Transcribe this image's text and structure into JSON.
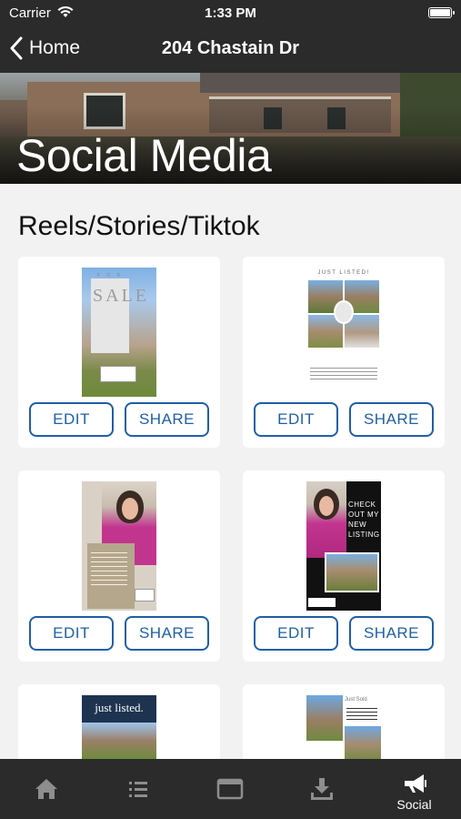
{
  "status_bar": {
    "carrier": "Carrier",
    "time": "1:33 PM"
  },
  "nav": {
    "back_label": "Home",
    "title": "204 Chastain Dr"
  },
  "hero": {
    "title": "Social Media"
  },
  "section": {
    "title": "Reels/Stories/Tiktok"
  },
  "cards": [
    {
      "edit_label": "EDIT",
      "share_label": "SHARE",
      "thumb": {
        "top_text": "F O R",
        "headline": "SALE"
      }
    },
    {
      "edit_label": "EDIT",
      "share_label": "SHARE",
      "thumb": {
        "headline": "JUST LISTED!"
      }
    },
    {
      "edit_label": "EDIT",
      "share_label": "SHARE"
    },
    {
      "edit_label": "EDIT",
      "share_label": "SHARE",
      "thumb": {
        "headline": "CHECK OUT MY NEW LISTING"
      }
    },
    {
      "thumb": {
        "headline": "just listed."
      }
    },
    {
      "thumb": {
        "headline": "Just Sold"
      }
    }
  ],
  "tabs": [
    {
      "icon": "home-icon",
      "label": ""
    },
    {
      "icon": "list-icon",
      "label": ""
    },
    {
      "icon": "browser-icon",
      "label": ""
    },
    {
      "icon": "download-icon",
      "label": ""
    },
    {
      "icon": "megaphone-icon",
      "label": "Social"
    }
  ],
  "colors": {
    "bar_bg": "#2b2b2b",
    "accent": "#1f5fa6",
    "page_bg": "#f2f2f2"
  }
}
